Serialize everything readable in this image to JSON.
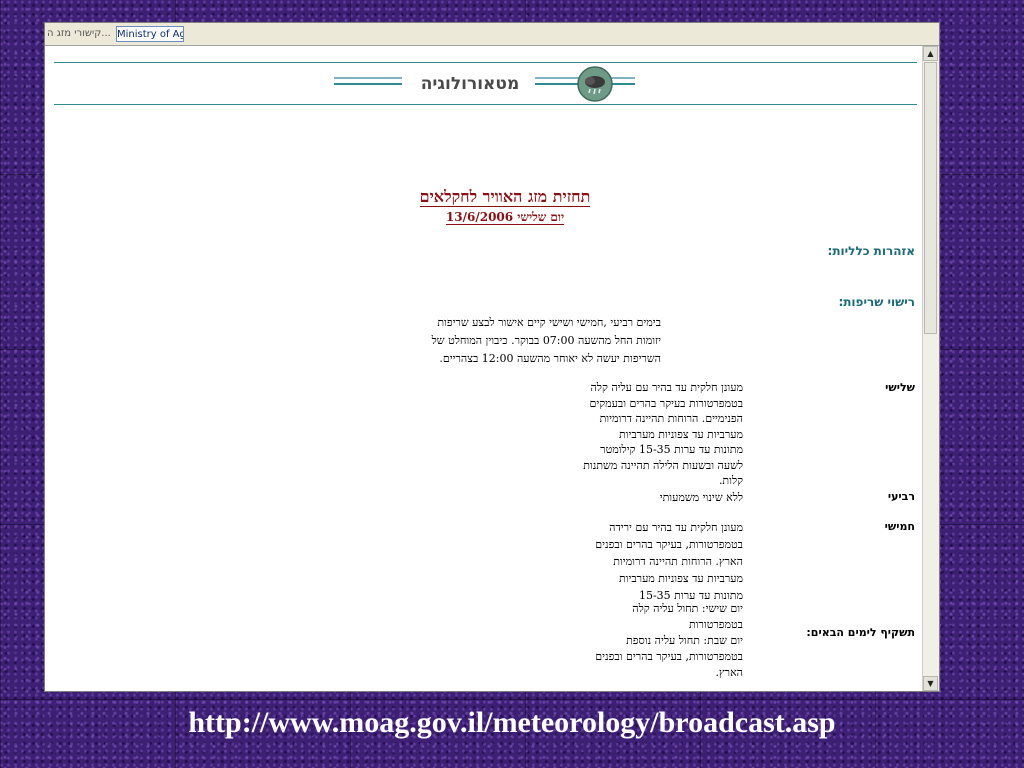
{
  "browser": {
    "tabs": [
      {
        "label": "קישורי מזג ה..."
      },
      {
        "label": "Ministry of Agr"
      }
    ]
  },
  "header": {
    "site_title": "מטאורולוגיה"
  },
  "forecast": {
    "title": "תחזית מזג האוויר לחקלאים",
    "date": "יום שלישי 13/6/2006"
  },
  "sections": {
    "general_head": "אזהרות כלליות:",
    "burn_head": "רישוי שריפות:",
    "burn_text": [
      "בימים רביעי ,חמישי ושישי קיים אישור לבצע שריפות",
      "יזומות החל מהשעה 07:00 בבוקר. כיבוין המוחלט של",
      "השריפות יעשה לא יאוחר מהשעה 12:00 בצהריים."
    ]
  },
  "days": [
    {
      "label": "שלישי",
      "text": [
        "מעונן חלקית עד בהיר עם עליה קלה",
        "בטמפרטורות בעיקר בהרים ובעמקים",
        "הפנימיים. הרוחות תהיינה דרומיות",
        "מערביות עד צפוניות מערביות",
        "מתונות עד ערות 15-35 קילומטר",
        "לשעה ובשעות הלילה תהיינה משתנות",
        "קלות."
      ]
    },
    {
      "label": "רביעי",
      "text": [
        "ללא שינוי משמעותי"
      ]
    },
    {
      "label": "חמישי",
      "text": [
        "מעונן חלקית עד בהיר עם ירידה",
        "בטמפרטורות, בעיקר בהרים ובפנים",
        "הארץ. הרוחות תהיינה דרומיות",
        "מערביות עד צפוניות מערביות",
        "מתונות עד ערות 15-35"
      ]
    },
    {
      "label": "תשקיף לימים הבאים:",
      "text": [
        "יום שישי: תחול עליה קלה",
        "בטמפרטורות",
        "יום שבת: תחול עליה נוספת",
        "בטמפרטורות, בעיקר בהרים ובפנים",
        "הארץ."
      ]
    }
  ],
  "footer": {
    "url": "http://www.moag.gov.il/meteorology/broadcast.asp"
  },
  "icons": {
    "logo": "weather-cloud-icon",
    "scroll_up": "arrow-up-icon",
    "scroll_down": "arrow-down-icon"
  }
}
